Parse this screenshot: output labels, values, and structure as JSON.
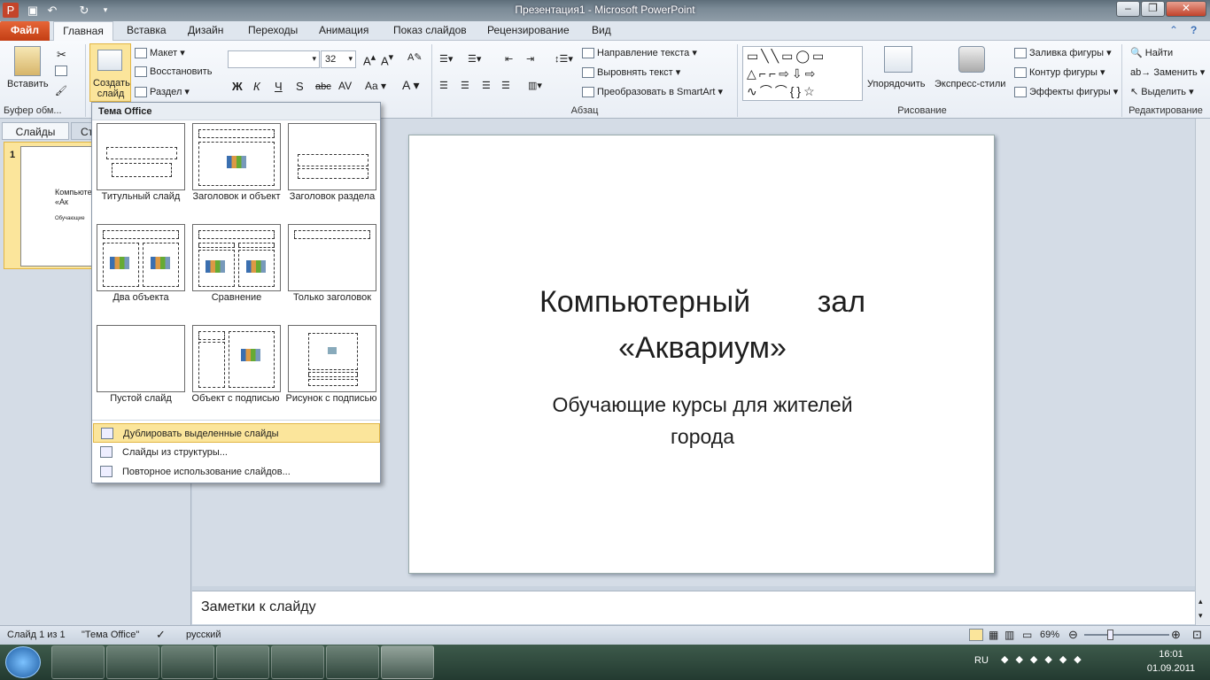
{
  "window": {
    "title": "Презентация1  -  Microsoft PowerPoint"
  },
  "ribbon_tabs": {
    "file": "Файл",
    "home": "Главная",
    "insert": "Вставка",
    "design": "Дизайн",
    "transitions": "Переходы",
    "animation": "Анимация",
    "slideshow": "Показ слайдов",
    "review": "Рецензирование",
    "view": "Вид"
  },
  "ribbon": {
    "clipboard": {
      "paste": "Вставить",
      "label": "Буфер обм..."
    },
    "slides": {
      "new_slide": "Создать слайд",
      "layout": "Макет",
      "reset": "Восстановить",
      "section": "Раздел"
    },
    "font": {
      "size": "32"
    },
    "paragraph": {
      "text_direction": "Направление текста",
      "align_text": "Выровнять текст",
      "smartart": "Преобразовать в SmartArt",
      "label": "Абзац"
    },
    "drawing": {
      "arrange": "Упорядочить",
      "quick_styles": "Экспресс-стили",
      "fill": "Заливка фигуры",
      "outline": "Контур фигуры",
      "effects": "Эффекты фигуры",
      "label": "Рисование"
    },
    "editing": {
      "find": "Найти",
      "replace": "Заменить",
      "select": "Выделить",
      "label": "Редактирование"
    }
  },
  "left_pane": {
    "tab_slides": "Слайды",
    "tab_outline": "Ст",
    "slide_number": "1",
    "thumb_title": "Компьютерный «Ак",
    "thumb_sub": "Обучающие"
  },
  "dropdown": {
    "header": "Тема Office",
    "layouts": [
      "Титульный слайд",
      "Заголовок и объект",
      "Заголовок раздела",
      "Два объекта",
      "Сравнение",
      "Только заголовок",
      "Пустой слайд",
      "Объект с подписью",
      "Рисунок с подписью"
    ],
    "menu": [
      "Дублировать выделенные слайды",
      "Слайды из структуры...",
      "Повторное использование слайдов..."
    ]
  },
  "slide": {
    "title_line1": "Компьютерный        зал",
    "title_line2": "«Аквариум»",
    "subtitle_line1": "Обучающие курсы для жителей",
    "subtitle_line2": "города"
  },
  "notes": {
    "placeholder": "Заметки к слайду"
  },
  "status": {
    "slide": "Слайд 1 из 1",
    "theme": "\"Тема Office\"",
    "language": "русский",
    "zoom": "69%"
  },
  "taskbar": {
    "lang": "RU",
    "time": "16:01",
    "date": "01.09.2011"
  },
  "colors": {
    "file_tab": "#d2491c",
    "selection": "#fbe59b"
  }
}
